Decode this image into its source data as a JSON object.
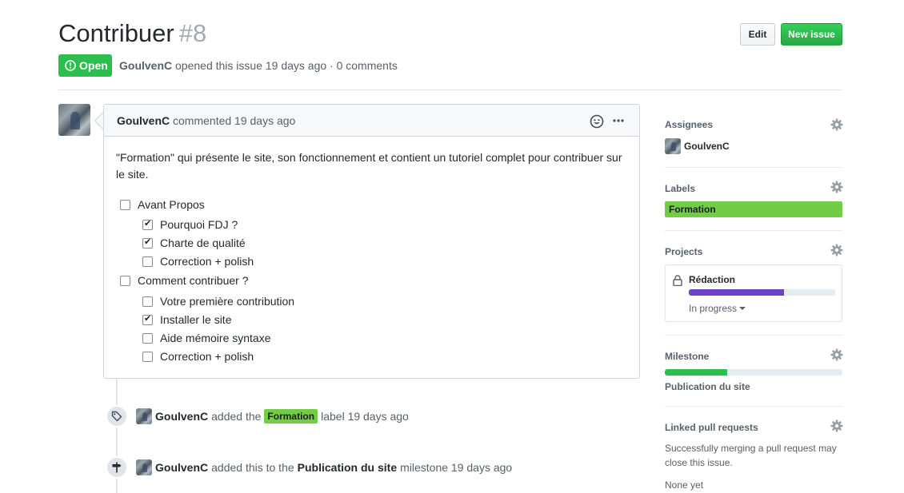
{
  "issue": {
    "title": "Contribuer",
    "number": "#8",
    "state": "Open",
    "author": "GoulvenC",
    "meta_text": "opened this issue 19 days ago · 0 comments"
  },
  "header_buttons": {
    "edit": "Edit",
    "new_issue": "New issue"
  },
  "comment": {
    "author": "GoulvenC",
    "time": "commented 19 days ago",
    "body": "\"Formation\" qui présente le site, son fonctionnement et contient un tutoriel complet pour contribuer sur le site.",
    "tasks": [
      {
        "label": "Avant Propos",
        "checked": false,
        "level": 0
      },
      {
        "label": "Pourquoi FDJ ?",
        "checked": true,
        "level": 1
      },
      {
        "label": "Charte de qualité",
        "checked": true,
        "level": 1
      },
      {
        "label": "Correction + polish",
        "checked": false,
        "level": 1
      },
      {
        "label": "Comment contribuer ?",
        "checked": false,
        "level": 0
      },
      {
        "label": "Votre première contribution",
        "checked": false,
        "level": 1
      },
      {
        "label": "Installer le site",
        "checked": true,
        "level": 1
      },
      {
        "label": "Aide mémoire syntaxe",
        "checked": false,
        "level": 1
      },
      {
        "label": "Correction + polish",
        "checked": false,
        "level": 1
      }
    ]
  },
  "timeline": {
    "label_event": {
      "actor": "GoulvenC",
      "pre": "added the",
      "label": "Formation",
      "post": "label 19 days ago"
    },
    "milestone_event": {
      "actor": "GoulvenC",
      "pre": "added this to the",
      "milestone": "Publication du site",
      "post": "milestone 19 days ago"
    }
  },
  "sidebar": {
    "assignees": {
      "title": "Assignees",
      "user": "GoulvenC"
    },
    "labels": {
      "title": "Labels",
      "label": "Formation",
      "color": "#72cc46"
    },
    "projects": {
      "title": "Projects",
      "name": "Rédaction",
      "progress": 0.65,
      "progress_color": "#6f42c1",
      "status": "In progress"
    },
    "milestone": {
      "title": "Milestone",
      "name": "Publication du site",
      "progress": 0.35,
      "progress_color": "#2cbe4e"
    },
    "linked_prs": {
      "title": "Linked pull requests",
      "description": "Successfully merging a pull request may close this issue.",
      "none": "None yet"
    }
  },
  "colors": {
    "open_green": "#2cbe4e",
    "label_green": "#72cc46",
    "project_purple": "#6f42c1"
  }
}
